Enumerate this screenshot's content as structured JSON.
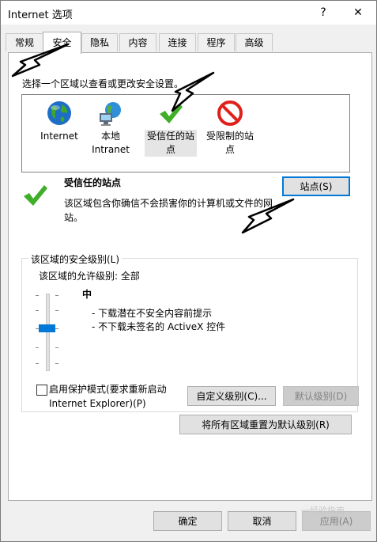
{
  "window": {
    "title": "Internet 选项",
    "help": "?",
    "close": "✕"
  },
  "tabs": [
    "常规",
    "安全",
    "隐私",
    "内容",
    "连接",
    "程序",
    "高级"
  ],
  "active_tab": "安全",
  "zone_prompt": "选择一个区域以查看或更改安全设置。",
  "zones": [
    {
      "label": "Internet",
      "icon": "globe-icon"
    },
    {
      "label": "本地\nIntranet",
      "icon": "local-intranet-icon"
    },
    {
      "label": "受信任的站\n点",
      "icon": "checkmark-icon",
      "selected": true
    },
    {
      "label": "受限制的站\n点",
      "icon": "no-entry-icon"
    }
  ],
  "selected_zone": {
    "title": "受信任的站点",
    "description": "该区域包含你确信不会损害你的计算机或文件的网站。",
    "sites_button": "站点(S)"
  },
  "security_level": {
    "group_label": "该区域的安全级别(L)",
    "allowed": "该区域的允许级别: 全部",
    "level": "中",
    "bullets": [
      "- 下载潜在不安全内容前提示",
      "- 不下载未签名的 ActiveX 控件"
    ],
    "slider_level": 0.5
  },
  "protected_mode": {
    "label": "启用保护模式(要求重新启动\nInternet Explorer)(P)",
    "checked": false
  },
  "buttons": {
    "custom": "自定义级别(C)...",
    "default": "默认级别(D)",
    "reset_all": "将所有区域重置为默认级别(R)",
    "ok": "确定",
    "cancel": "取消",
    "apply": "应用(A)"
  },
  "colors": {
    "accent": "#0078d7",
    "check_green": "#3fae29",
    "restricted_red": "#e0201b"
  },
  "watermark": "一经验指南"
}
